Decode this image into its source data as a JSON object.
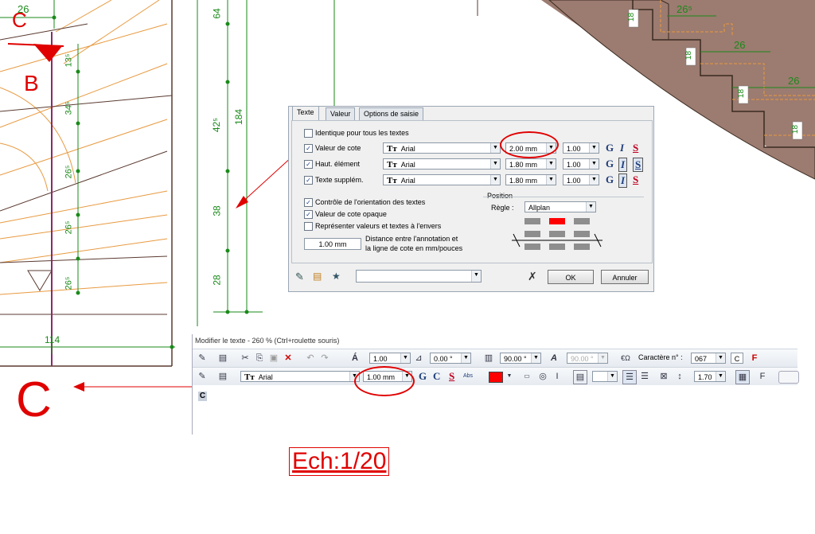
{
  "drawing": {
    "left_dims": [
      "26",
      "13⁵",
      "34⁵",
      "26⁵",
      "26⁵",
      "26⁵",
      "114"
    ],
    "mid_dims": [
      "64",
      "184",
      "42⁵",
      "38",
      "28"
    ],
    "stair_heights": [
      "18",
      "18",
      "18",
      "18"
    ],
    "stair_widths": [
      "26⁵",
      "26",
      "26"
    ],
    "label_c_top": "C",
    "label_b": "B",
    "label_c_big": "C",
    "scale_text": "Ech:1/20"
  },
  "dialog": {
    "tabs": [
      "Texte",
      "Valeur",
      "Options de saisie"
    ],
    "identical_label": "Identique pour tous les textes",
    "rows": [
      {
        "checked": true,
        "label": "Valeur de cote",
        "font": "Arial",
        "size": "2.00 mm",
        "ratio": "1.00",
        "fmt_icons": [
          "G",
          "I",
          "S"
        ]
      },
      {
        "checked": true,
        "label": "Haut. élément",
        "font": "Arial",
        "size": "1.80 mm",
        "ratio": "1.00",
        "fmt_icons": [
          "G",
          "I",
          "S"
        ]
      },
      {
        "checked": true,
        "label": "Texte supplém.",
        "font": "Arial",
        "size": "1.80 mm",
        "ratio": "1.00",
        "fmt_icons": [
          "G",
          "I",
          "S"
        ]
      }
    ],
    "options": [
      {
        "checked": true,
        "label": "Contrôle de l'orientation des textes"
      },
      {
        "checked": true,
        "label": "Valeur de cote opaque"
      },
      {
        "checked": false,
        "label": "Représenter valeurs et textes à l'envers"
      }
    ],
    "distance_value": "1.00 mm",
    "distance_label_1": "Distance entre l'annotation et",
    "distance_label_2": "la ligne de cote en mm/pouces",
    "position_title": "Position",
    "regle_label": "Règle :",
    "regle_value": "Allplan",
    "ok_label": "OK",
    "cancel_label": "Annuler",
    "bottom_combo": "",
    "accent_red": "#ff0000"
  },
  "editor": {
    "title": "Modifier le texte - 260 % (Ctrl+roulette souris)",
    "row1": {
      "height_value": "1.00",
      "angle_value": "0.00 °",
      "slant_value": "90.00 °",
      "disabled_value": "90.00 °",
      "char_label": "Caractère n° :",
      "char_value": "067",
      "char_preview": "C"
    },
    "row2": {
      "font": "Arial",
      "size": "1.00 mm",
      "fmt_icons": [
        "G",
        "C",
        "S"
      ],
      "abs_label": "Abs",
      "ratio": "1.70"
    },
    "content": "C"
  }
}
